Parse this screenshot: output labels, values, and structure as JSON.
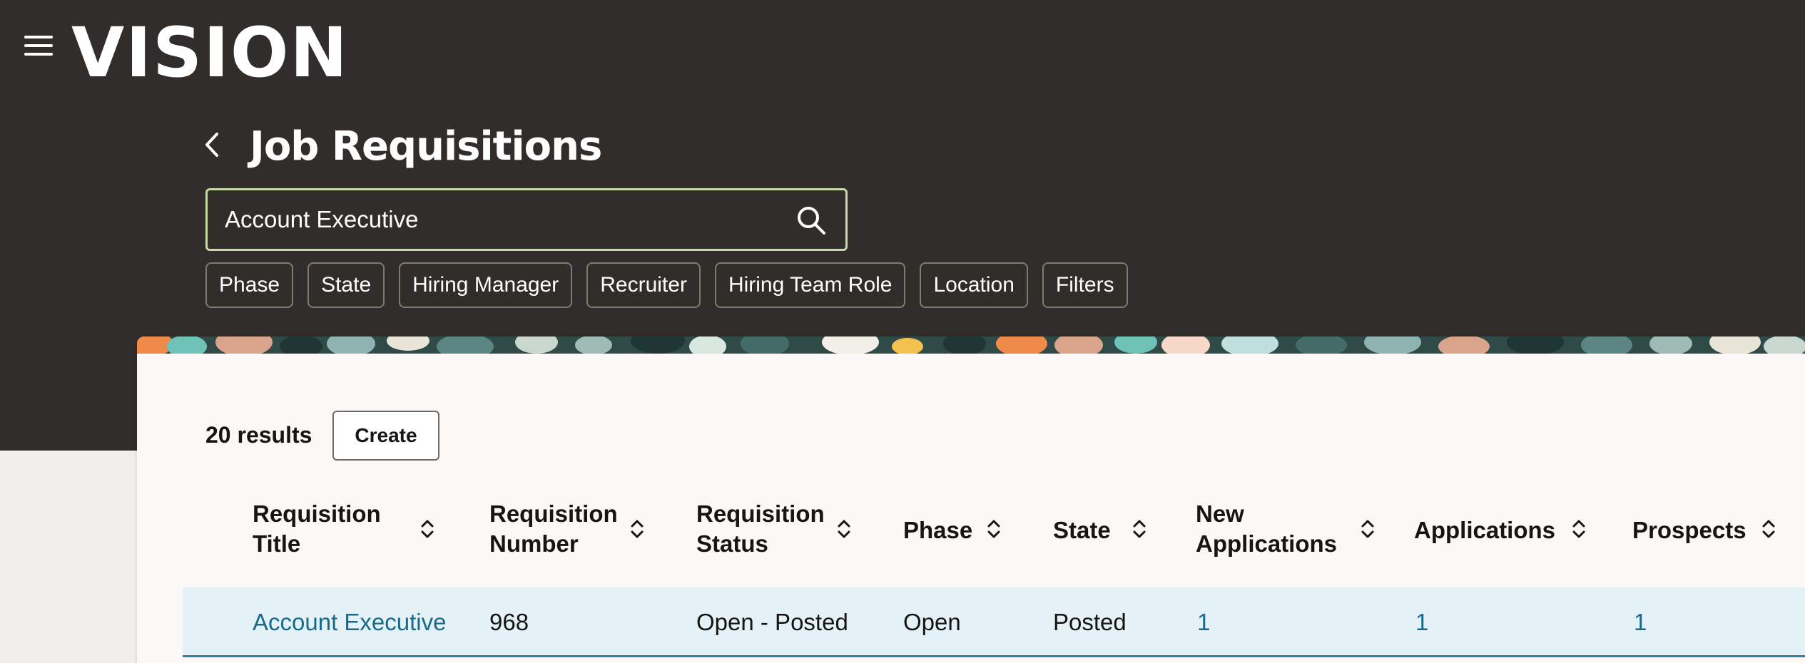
{
  "app": {
    "logo_text": "VISION",
    "page_title": "Job Requisitions"
  },
  "search": {
    "value": "Account Executive",
    "placeholder": ""
  },
  "filter_chips": [
    "Phase",
    "State",
    "Hiring Manager",
    "Recruiter",
    "Hiring Team Role",
    "Location",
    "Filters"
  ],
  "results": {
    "count_label": "20 results",
    "create_label": "Create"
  },
  "table": {
    "columns": [
      {
        "line1": "Requisition",
        "line2": "Title"
      },
      {
        "line1": "Requisition",
        "line2": "Number"
      },
      {
        "line1": "Requisition",
        "line2": "Status"
      },
      {
        "line1": "Phase",
        "line2": ""
      },
      {
        "line1": "State",
        "line2": ""
      },
      {
        "line1": "New",
        "line2": "Applications"
      },
      {
        "line1": "Applications",
        "line2": ""
      },
      {
        "line1": "Prospects",
        "line2": ""
      }
    ],
    "rows": [
      [
        "Account Executive",
        "968",
        "Open - Posted",
        "Open",
        "Posted",
        "1",
        "1",
        "1"
      ]
    ]
  },
  "colors": {
    "header_bg": "#312d2a",
    "card_bg": "#fbf8f6",
    "link": "#176b8a",
    "selected_row": "#e4f1f7",
    "search_border": "#c6d9a6"
  },
  "icons": {
    "menu": "hamburger-menu-icon",
    "back": "chevron-left-icon",
    "search": "search-icon",
    "sort": "sort-up-down-icon"
  }
}
